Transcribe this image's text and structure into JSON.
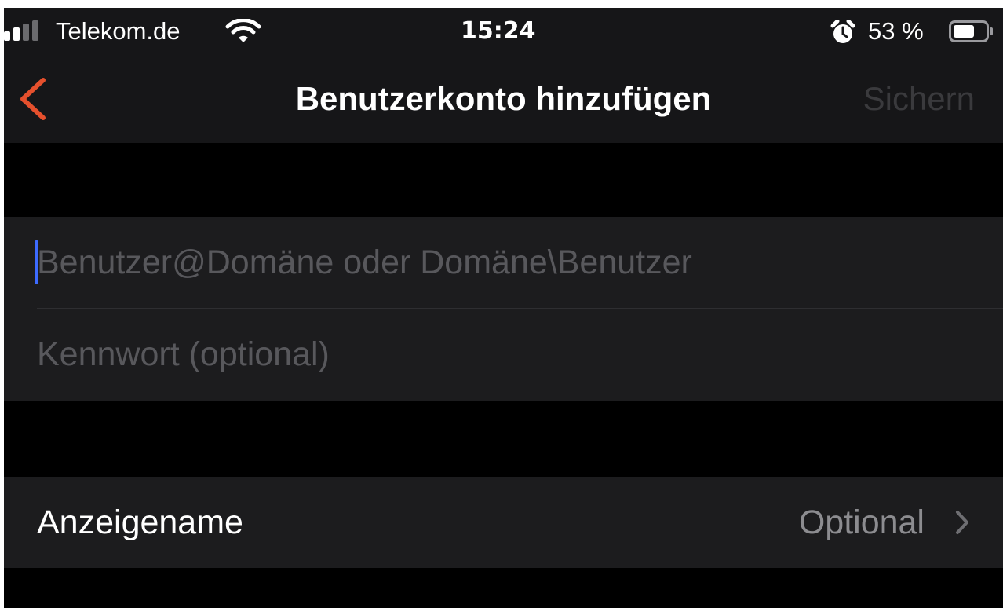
{
  "status_bar": {
    "carrier": "Telekom.de",
    "time": "15:24",
    "battery": "53 %"
  },
  "nav": {
    "title": "Benutzerkonto hinzufügen",
    "save_label": "Sichern"
  },
  "form": {
    "user_field": {
      "placeholder": "Benutzer@Domäne oder Domäne\\Benutzer",
      "value": ""
    },
    "password_field": {
      "placeholder": "Kennwort (optional)",
      "value": ""
    }
  },
  "display_name": {
    "label": "Anzeigename",
    "value": "Optional"
  },
  "colors": {
    "accent_back": "#e5502d",
    "caret": "#3d6bff",
    "background": "#000000",
    "bar": "#161618",
    "cell": "#1c1c1e"
  },
  "icons": [
    "signal-icon",
    "wifi-icon",
    "alarm-icon",
    "battery-icon",
    "back-chevron-icon",
    "chevron-right-icon"
  ]
}
